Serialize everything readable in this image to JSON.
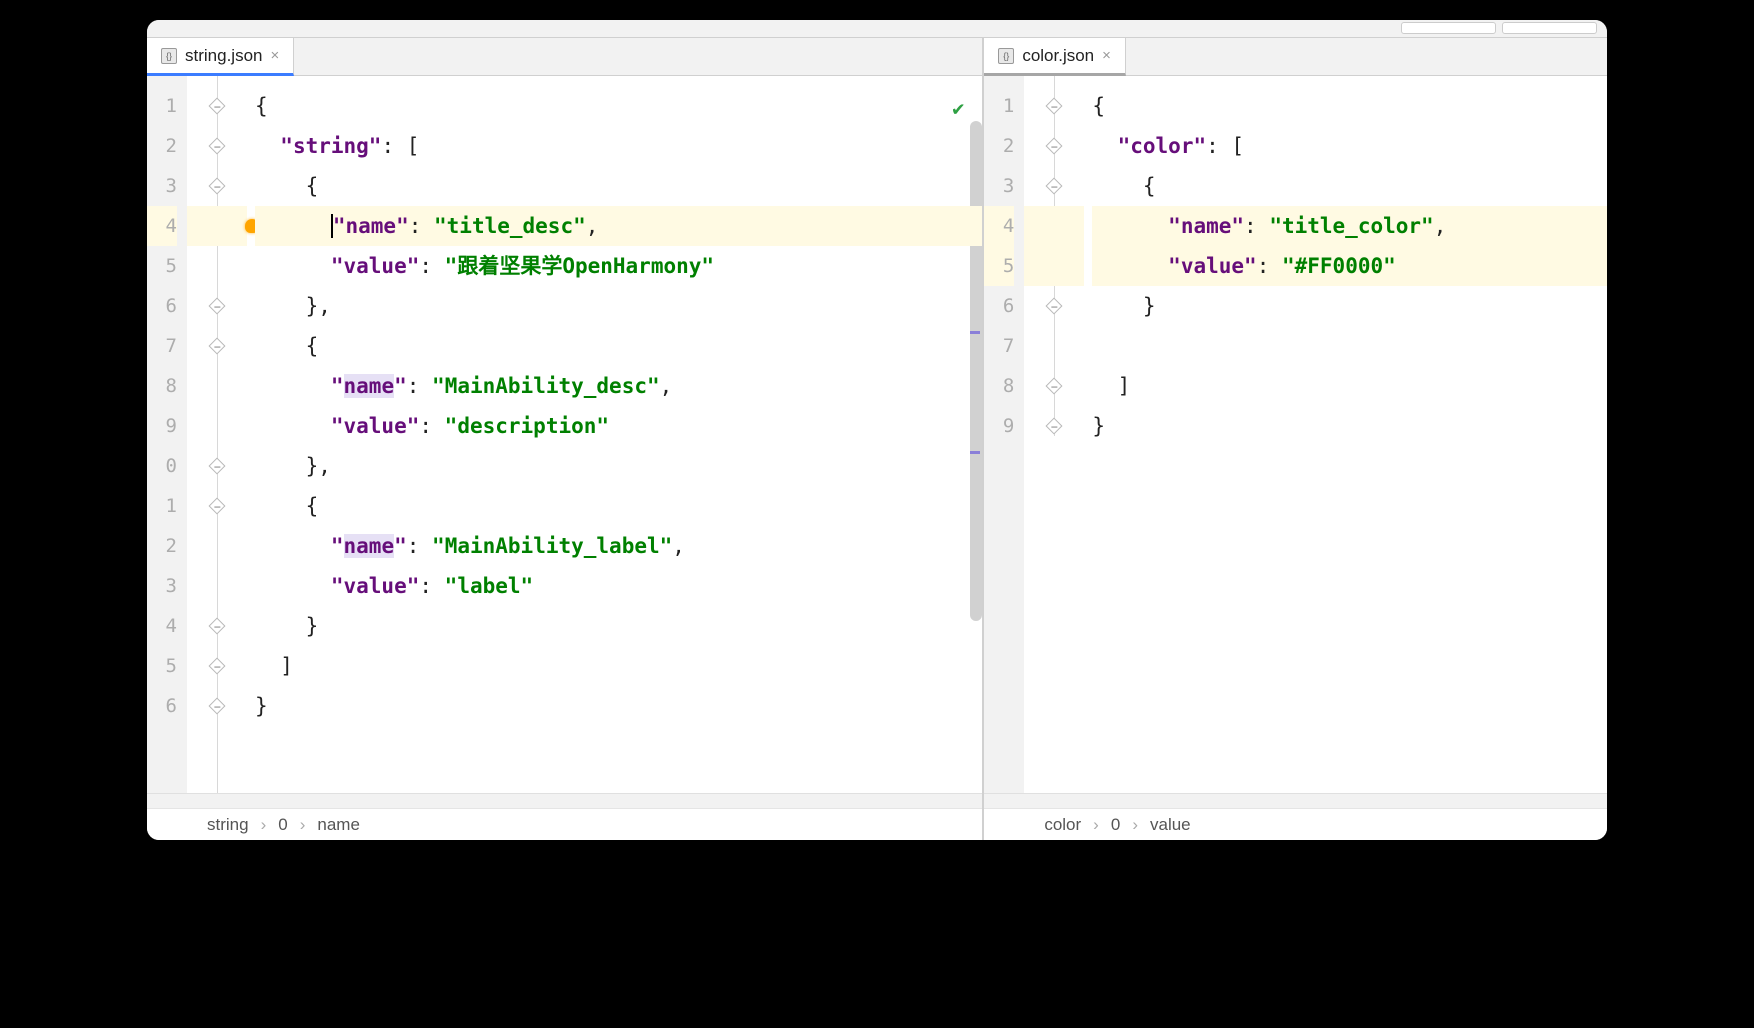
{
  "tabs": {
    "left": {
      "name": "string.json"
    },
    "right": {
      "name": "color.json"
    }
  },
  "left_editor": {
    "line_numbers": [
      "1",
      "2",
      "3",
      "4",
      "5",
      "6",
      "7",
      "8",
      "9",
      "0",
      "1",
      "2",
      "3",
      "4",
      "5",
      "6"
    ],
    "key_string": "\"string\"",
    "key_name": "\"name\"",
    "key_value": "\"value\"",
    "v1_name": "\"title_desc\"",
    "v1_value": "\"跟着坚果学OpenHarmony\"",
    "v2_name": "\"MainAbility_desc\"",
    "v2_value": "\"description\"",
    "v3_name": "\"MainAbility_label\"",
    "v3_value": "\"label\"",
    "colon": ": ",
    "obrack": "[",
    "cbrack": "]",
    "obrace": "{",
    "cbrace": "}",
    "cbrace_comma": "},",
    "comma": ","
  },
  "right_editor": {
    "line_numbers": [
      "1",
      "2",
      "3",
      "4",
      "5",
      "6",
      "7",
      "8",
      "9"
    ],
    "key_color": "\"color\"",
    "key_name": "\"name\"",
    "key_value": "\"value\"",
    "v_name": "\"title_color\"",
    "v_value": "\"#FF0000\"",
    "swatch_color": "#FF0000",
    "colon": ": ",
    "obrack": "[",
    "cbrack": "]",
    "obrace": "{",
    "cbrace": "}",
    "comma": ","
  },
  "breadcrumbs": {
    "left": [
      "string",
      "0",
      "name"
    ],
    "right": [
      "color",
      "0",
      "value"
    ],
    "sep": "›"
  }
}
